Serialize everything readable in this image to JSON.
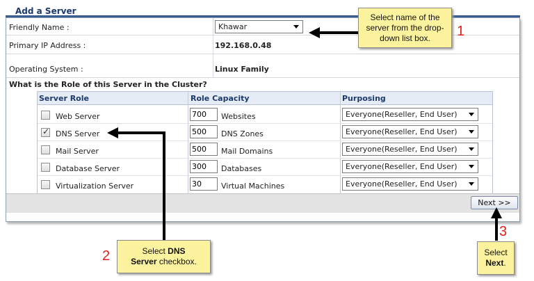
{
  "title": "Add a Server",
  "fields": {
    "friendly_name_label": "Friendly Name :",
    "friendly_name_value": "Khawar",
    "ip_label": "Primary IP Address :",
    "ip_value": "192.168.0.48",
    "os_label": "Operating System :",
    "os_value": "Linux Family"
  },
  "question": "What is the Role of this Server in the Cluster?",
  "table": {
    "headers": [
      "Server Role",
      "Role Capacity",
      "Purposing"
    ],
    "rows": [
      {
        "role": "Web Server",
        "checked": false,
        "capacity": "700",
        "unit": "Websites",
        "purposing": "Everyone(Reseller, End User)"
      },
      {
        "role": "DNS Server",
        "checked": true,
        "capacity": "500",
        "unit": "DNS Zones",
        "purposing": "Everyone(Reseller, End User)"
      },
      {
        "role": "Mail Server",
        "checked": false,
        "capacity": "500",
        "unit": "Mail Domains",
        "purposing": "Everyone(Reseller, End User)"
      },
      {
        "role": "Database Server",
        "checked": false,
        "capacity": "300",
        "unit": "Databases",
        "purposing": "Everyone(Reseller, End User)"
      },
      {
        "role": "Virtualization Server",
        "checked": false,
        "capacity": "30",
        "unit": "Virtual Machines",
        "purposing": "Everyone(Reseller, End User)"
      }
    ]
  },
  "next_label": "Next >>",
  "callouts": {
    "c1_text": "Select name of the server from the drop-down list box.",
    "c1_num": "1",
    "c2_line1_pre": "Select ",
    "c2_line1_bold": "DNS",
    "c2_line2_bold": "Server",
    "c2_line2_post": " checkbox.",
    "c2_num": "2",
    "c3_line1": "Select",
    "c3_line2_bold": "Next",
    "c3_line2_post": ".",
    "c3_num": "3"
  }
}
